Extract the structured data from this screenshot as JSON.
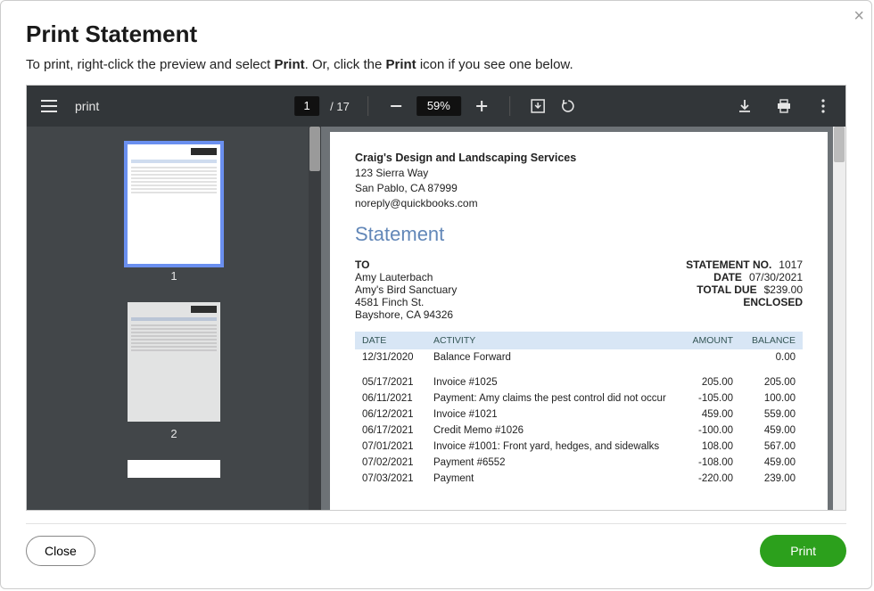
{
  "modal": {
    "title": "Print Statement",
    "instruction_pre": "To print, right-click the preview and select ",
    "instruction_bold1": "Print",
    "instruction_mid": ". Or, click the ",
    "instruction_bold2": "Print",
    "instruction_post": " icon if you see one below."
  },
  "toolbar": {
    "doc_name": "print",
    "current_page": "1",
    "page_sep": "/ 17",
    "zoom": "59%"
  },
  "thumbs": {
    "labels": [
      "1",
      "2"
    ]
  },
  "document": {
    "company_name": "Craig's Design and Landscaping Services",
    "addr1": "123 Sierra Way",
    "addr2": "San Pablo, CA  87999",
    "email": "noreply@quickbooks.com",
    "heading": "Statement",
    "to_label": "TO",
    "to_name": "Amy Lauterbach",
    "to_company": "Amy's Bird Sanctuary",
    "to_addr1": "4581 Finch St.",
    "to_addr2": "Bayshore, CA  94326",
    "meta": {
      "statement_no_label": "STATEMENT NO.",
      "statement_no": "1017",
      "date_label": "DATE",
      "date": "07/30/2021",
      "total_due_label": "TOTAL DUE",
      "total_due": "$239.00",
      "enclosed_label": "ENCLOSED"
    },
    "columns": {
      "date": "DATE",
      "activity": "ACTIVITY",
      "amount": "AMOUNT",
      "balance": "BALANCE"
    },
    "rows": [
      {
        "date": "12/31/2020",
        "activity": "Balance Forward",
        "amount": "",
        "balance": "0.00",
        "gap_after": true
      },
      {
        "date": "05/17/2021",
        "activity": "Invoice #1025",
        "amount": "205.00",
        "balance": "205.00"
      },
      {
        "date": "06/11/2021",
        "activity": "Payment: Amy claims the pest control did not occur",
        "amount": "-105.00",
        "balance": "100.00"
      },
      {
        "date": "06/12/2021",
        "activity": "Invoice #1021",
        "amount": "459.00",
        "balance": "559.00"
      },
      {
        "date": "06/17/2021",
        "activity": "Credit Memo #1026",
        "amount": "-100.00",
        "balance": "459.00"
      },
      {
        "date": "07/01/2021",
        "activity": "Invoice #1001: Front yard, hedges, and sidewalks",
        "amount": "108.00",
        "balance": "567.00"
      },
      {
        "date": "07/02/2021",
        "activity": "Payment #6552",
        "amount": "-108.00",
        "balance": "459.00"
      },
      {
        "date": "07/03/2021",
        "activity": "Payment",
        "amount": "-220.00",
        "balance": "239.00"
      }
    ]
  },
  "footer": {
    "close": "Close",
    "print": "Print"
  }
}
